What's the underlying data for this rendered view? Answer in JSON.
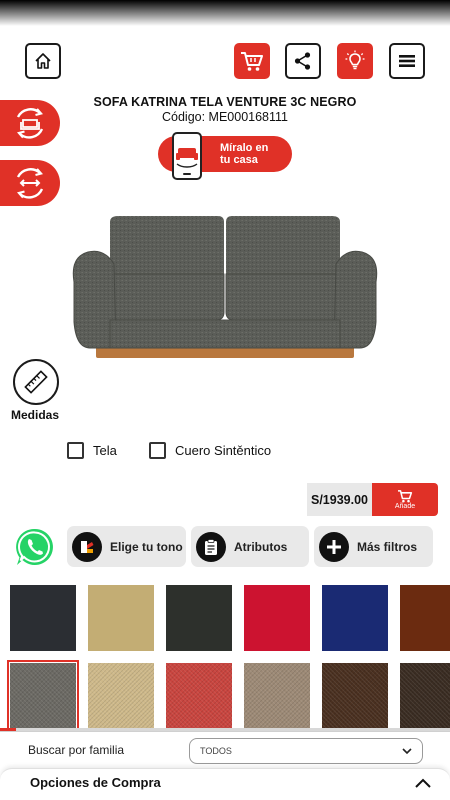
{
  "header": {
    "home_icon": "home-icon",
    "cart_icon": "cart-icon",
    "share_icon": "share-icon",
    "idea_icon": "lightbulb-icon",
    "menu_icon": "menu-icon"
  },
  "product": {
    "title": "SOFA KATRINA TELA VENTURE 3C NEGRO",
    "code": "Código: ME000168111"
  },
  "ar_button": {
    "line1": "Míralo en",
    "line2": "tu casa"
  },
  "measures": {
    "label": "Medidas"
  },
  "materials": [
    {
      "label": "Tela",
      "checked": false
    },
    {
      "label": "Cuero Sintěntico",
      "checked": false
    }
  ],
  "price": {
    "value": "S/1939.00",
    "add_label": "Añade"
  },
  "filters": [
    {
      "label": "Elige tu tono",
      "icon": "palette-icon"
    },
    {
      "label": "Atributos",
      "icon": "clipboard-icon"
    },
    {
      "label": "Más filtros",
      "icon": "plus-icon"
    }
  ],
  "swatches": {
    "row1": [
      "#2b2e33",
      "#c3ad74",
      "#2d302c",
      "#cc1330",
      "#1a2a73",
      "#6b2b10"
    ],
    "row2": [
      "#6c6a64",
      "#ceb98a",
      "#c9453f",
      "#9d8a76",
      "#4a3020",
      "#3a2c22"
    ],
    "selected_index": 6
  },
  "scroll_progress": 0.035,
  "bottom": {
    "family_label": "Buscar por familia",
    "family_value": "TODOS",
    "options_title": "Opciones de Compra"
  },
  "colors": {
    "accent": "#e03127"
  }
}
